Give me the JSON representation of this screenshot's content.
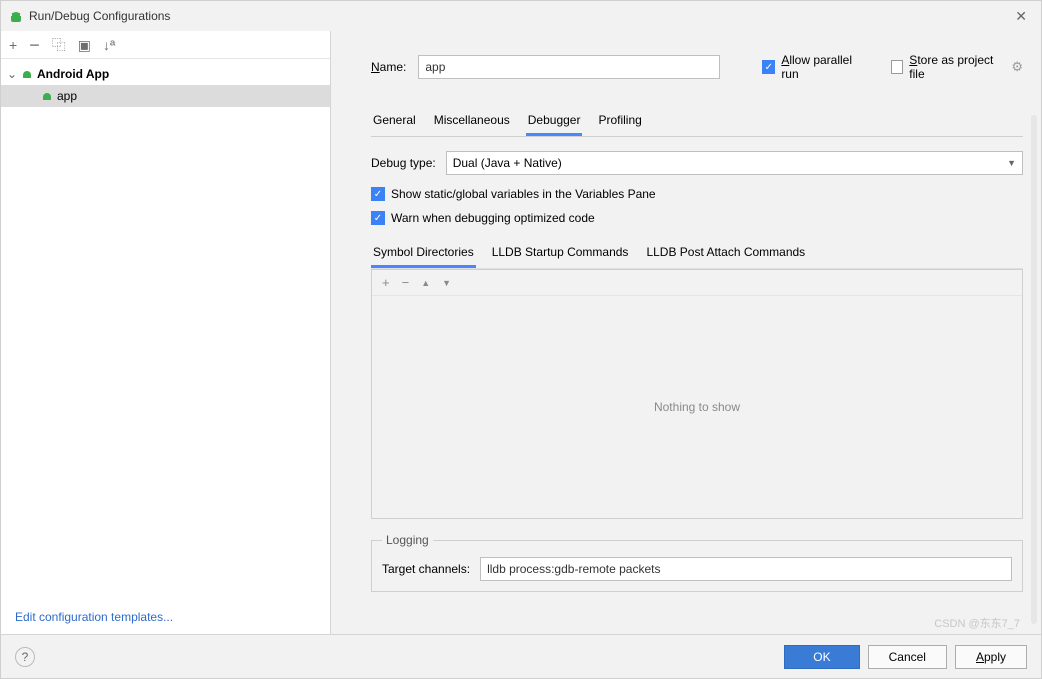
{
  "window": {
    "title": "Run/Debug Configurations"
  },
  "leftToolbar": {
    "add": "+",
    "remove": "−",
    "copy": "⿻",
    "save": "▣",
    "sort": "↓ª"
  },
  "tree": {
    "group": "Android App",
    "item": "app"
  },
  "editLink": "Edit configuration templates...",
  "form": {
    "nameLabel": "Name:",
    "nameValue": "app",
    "allowParallel": {
      "checked": true,
      "label": "Allow parallel run"
    },
    "storeProj": {
      "checked": false,
      "label": "Store as project file"
    }
  },
  "tabs": [
    "General",
    "Miscellaneous",
    "Debugger",
    "Profiling"
  ],
  "activeTab": 2,
  "debugger": {
    "typeLabel": "Debug type:",
    "typeValue": "Dual (Java + Native)",
    "showStatic": {
      "checked": true,
      "label": "Show static/global variables in the Variables Pane"
    },
    "warnOpt": {
      "checked": true,
      "label": "Warn when debugging optimized code"
    },
    "subtabs": [
      "Symbol Directories",
      "LLDB Startup Commands",
      "LLDB Post Attach Commands"
    ],
    "activeSub": 0,
    "panelTb": {
      "add": "+",
      "remove": "−",
      "up": "▲",
      "down": "▼"
    },
    "empty": "Nothing to show",
    "logging": {
      "legend": "Logging",
      "label": "Target channels:",
      "value": "lldb process:gdb-remote packets"
    }
  },
  "buttons": {
    "ok": "OK",
    "cancel": "Cancel",
    "apply": "Apply"
  },
  "watermark": "CSDN @东东7_7"
}
